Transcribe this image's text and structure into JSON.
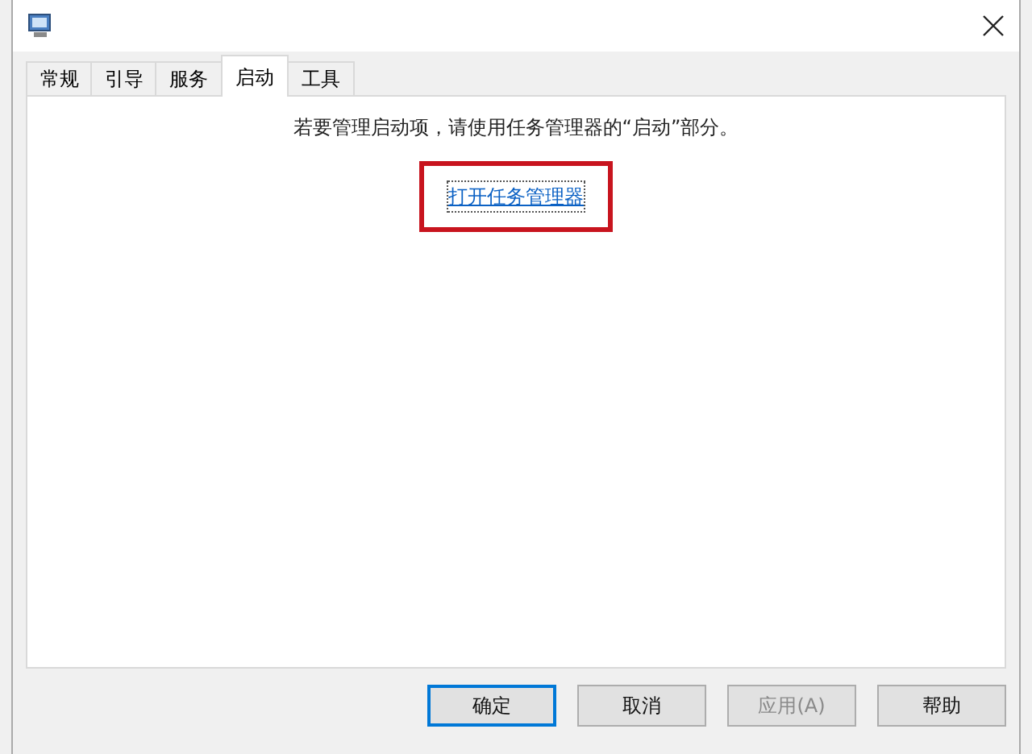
{
  "tabs": [
    {
      "label": "常规",
      "selected": false
    },
    {
      "label": "引导",
      "selected": false
    },
    {
      "label": "服务",
      "selected": false
    },
    {
      "label": "启动",
      "selected": true
    },
    {
      "label": "工具",
      "selected": false
    }
  ],
  "message": "若要管理启动项，请使用任务管理器的“启动”部分。",
  "link": {
    "label": "打开任务管理器",
    "highlighted": true
  },
  "buttons": [
    {
      "label": "确定",
      "default": true,
      "disabled": false
    },
    {
      "label": "取消",
      "default": false,
      "disabled": false
    },
    {
      "label": "应用(A)",
      "default": false,
      "disabled": true
    },
    {
      "label": "帮助",
      "default": false,
      "disabled": false
    }
  ]
}
